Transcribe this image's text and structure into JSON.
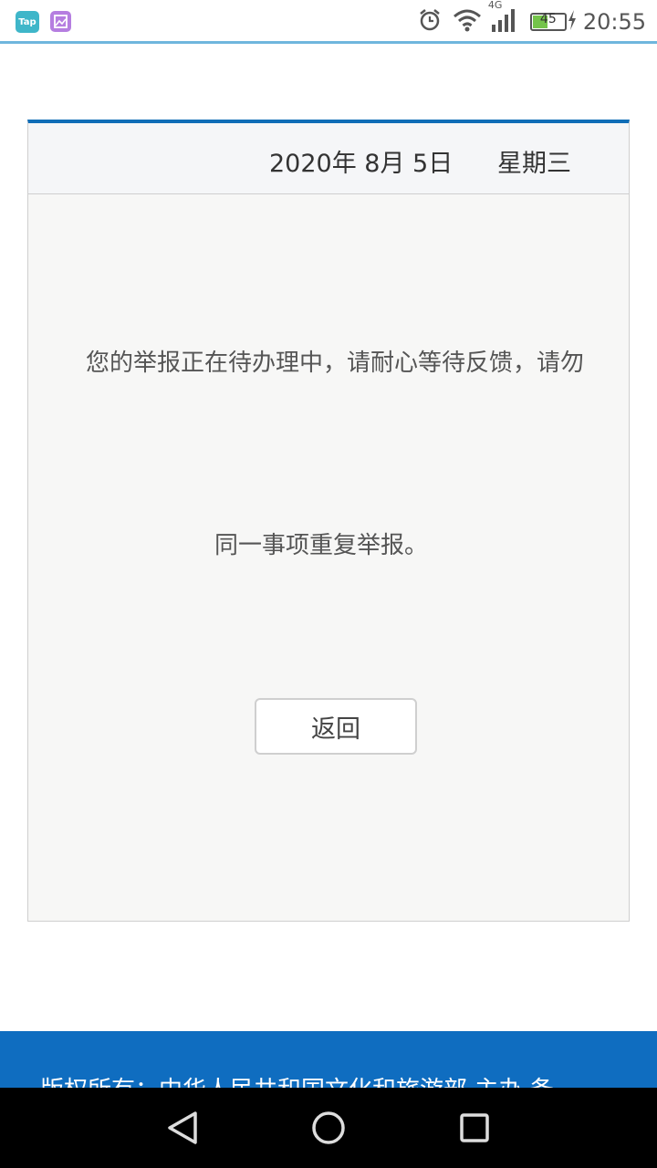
{
  "status_bar": {
    "app_icons": [
      "tap-icon",
      "gallery-icon"
    ],
    "tap_label": "Tap",
    "network": "4G",
    "battery_level": "45",
    "time": "20:55",
    "icons": [
      "alarm-icon",
      "wifi-icon",
      "signal-icon",
      "battery-icon",
      "charging-icon"
    ]
  },
  "header": {
    "date": "2020年 8月 5日",
    "weekday": "星期三"
  },
  "message": {
    "line1": "您的举报正在待办理中，请耐心等待反馈，请勿",
    "line2": "同一事项重复举报。"
  },
  "actions": {
    "back_label": "返回"
  },
  "footer": {
    "text": "版权所有：中华人民共和国文化和旅游部 主办 备"
  },
  "colors": {
    "accent": "#0f6db7",
    "footer_bg": "#0f6dc0",
    "status_line": "#6fb6dd"
  },
  "nav_bar": {
    "icons": [
      "back-triangle-icon",
      "home-circle-icon",
      "recent-square-icon"
    ]
  }
}
